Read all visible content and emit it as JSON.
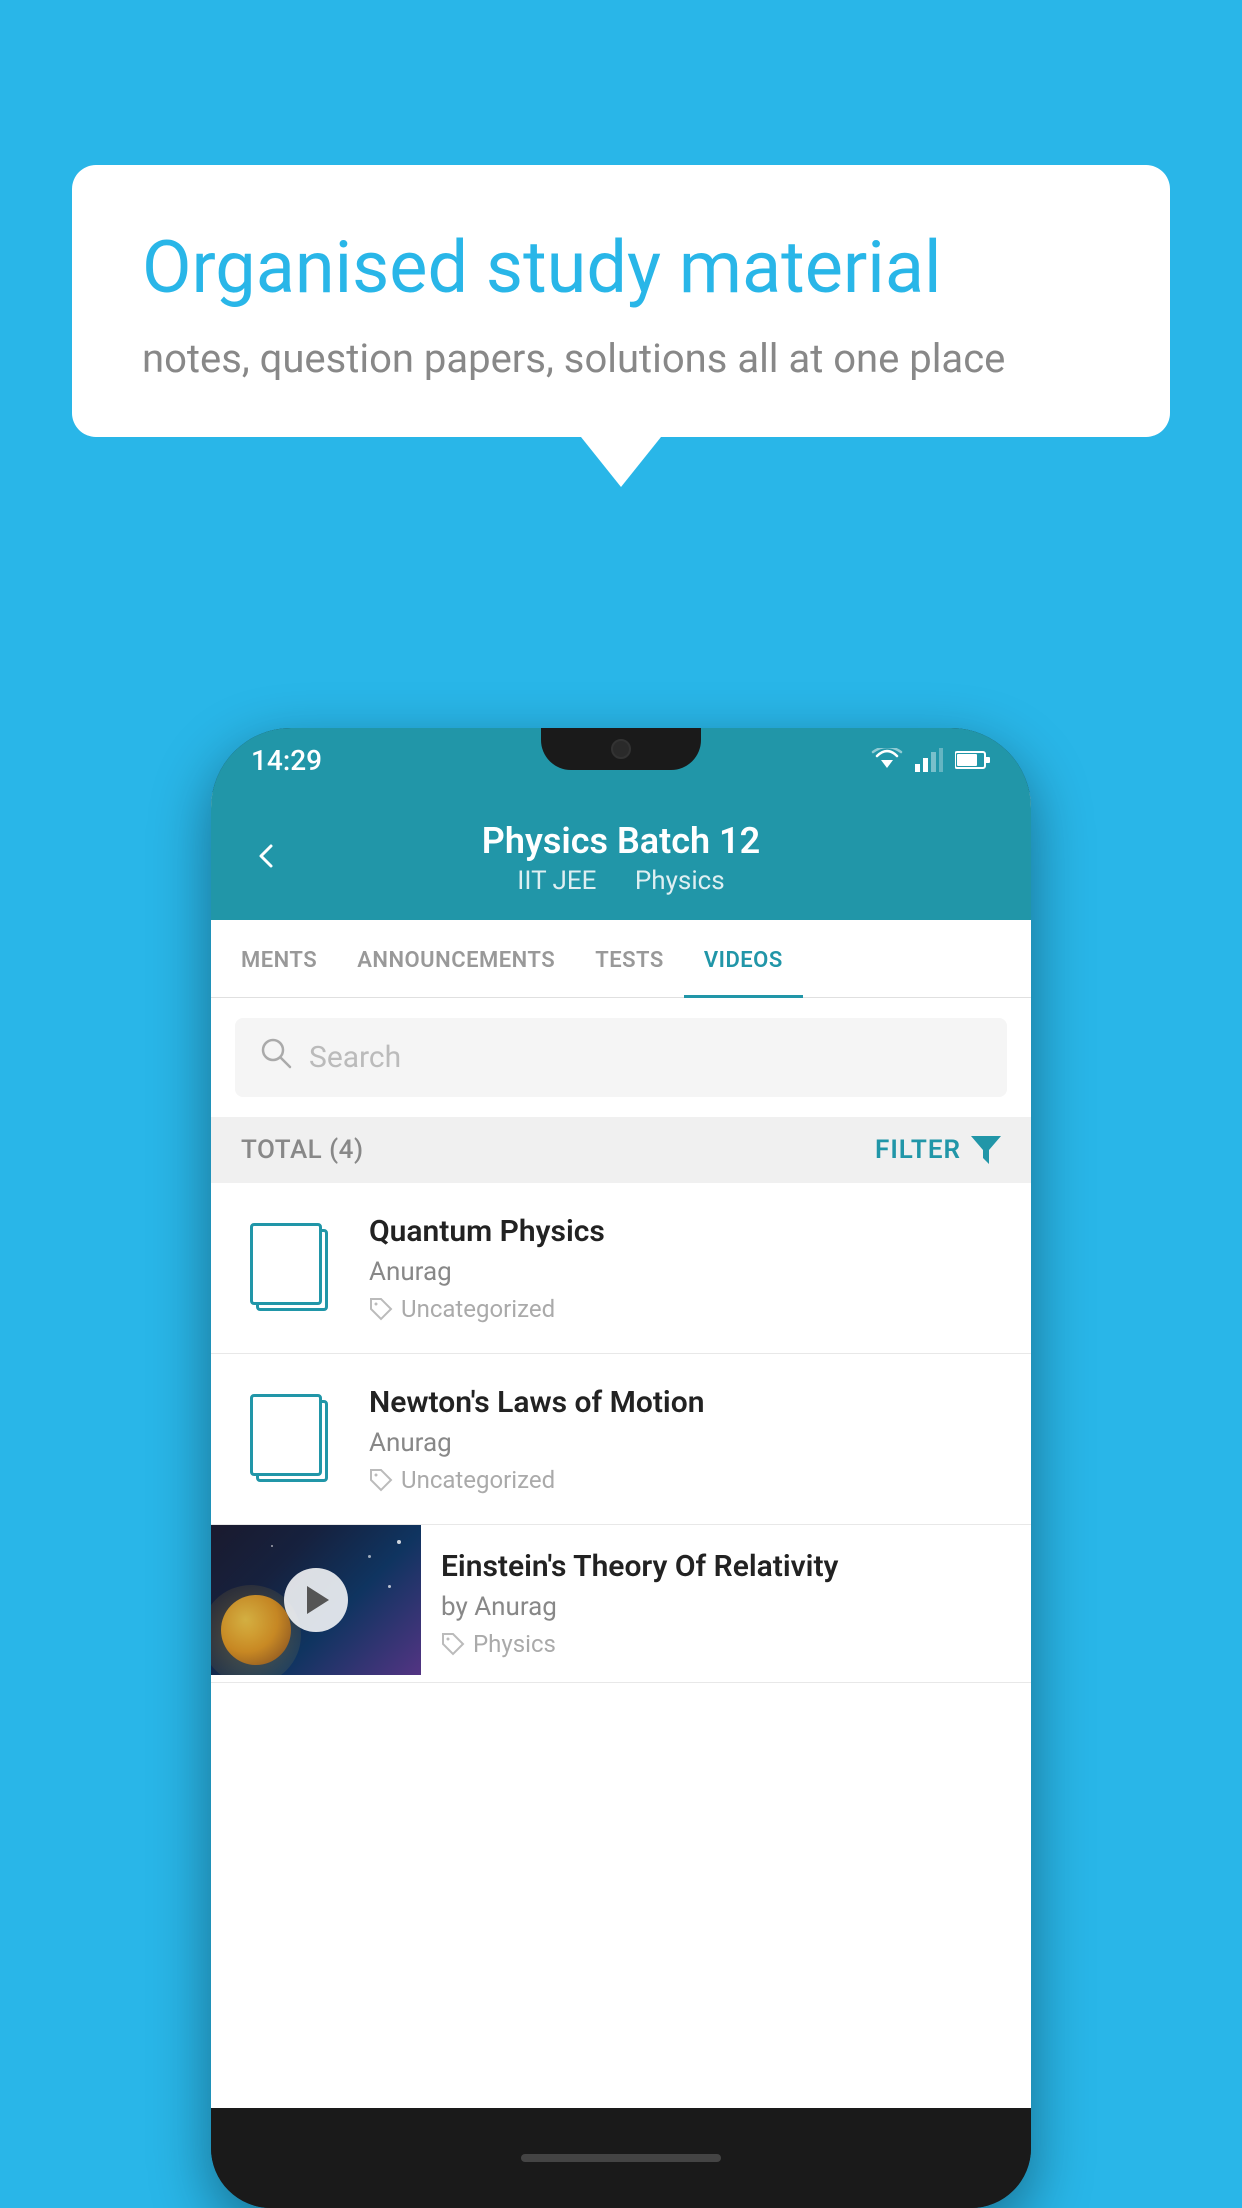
{
  "background": {
    "color": "#29B6E8"
  },
  "speech_bubble": {
    "title": "Organised study material",
    "subtitle": "notes, question papers, solutions all at one place"
  },
  "phone": {
    "status_bar": {
      "time": "14:29"
    },
    "header": {
      "back_label": "←",
      "title": "Physics Batch 12",
      "subtitle_part1": "IIT JEE",
      "subtitle_part2": "Physics"
    },
    "tabs": [
      {
        "label": "MENTS",
        "active": false
      },
      {
        "label": "ANNOUNCEMENTS",
        "active": false
      },
      {
        "label": "TESTS",
        "active": false
      },
      {
        "label": "VIDEOS",
        "active": true
      }
    ],
    "search": {
      "placeholder": "Search"
    },
    "filter_bar": {
      "total_label": "TOTAL (4)",
      "filter_label": "FILTER"
    },
    "videos": [
      {
        "id": 1,
        "title": "Quantum Physics",
        "author": "Anurag",
        "tag": "Uncategorized",
        "has_thumbnail": false
      },
      {
        "id": 2,
        "title": "Newton's Laws of Motion",
        "author": "Anurag",
        "tag": "Uncategorized",
        "has_thumbnail": false
      },
      {
        "id": 3,
        "title": "Einstein's Theory Of Relativity",
        "author": "by Anurag",
        "tag": "Physics",
        "has_thumbnail": true
      }
    ]
  }
}
